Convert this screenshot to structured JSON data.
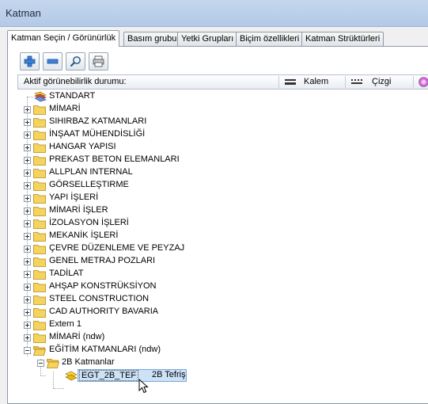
{
  "window": {
    "title": "Katman"
  },
  "tabs": [
    {
      "label": "Katman Seçin / Görünürlük"
    },
    {
      "label": "Basım grubu"
    },
    {
      "label": "Yetki Grupları"
    },
    {
      "label": "Biçim özellikleri"
    },
    {
      "label": "Katman Strüktürleri"
    }
  ],
  "toolbar": {
    "buttons": [
      {
        "icon": "plus-icon"
      },
      {
        "icon": "minus-icon"
      },
      {
        "icon": "magnifier-icon"
      },
      {
        "icon": "printer-icon"
      }
    ]
  },
  "columns": {
    "visibility": "Aktif görünebilirlik durumu:",
    "pen": "Kalem",
    "line": "Çizgi"
  },
  "tree": {
    "items": [
      {
        "label": "STANDART"
      },
      {
        "label": "MİMARİ"
      },
      {
        "label": "SIHIRBAZ KATMANLARI"
      },
      {
        "label": "İNŞAAT MÜHENDİSLİĞİ"
      },
      {
        "label": "HANGAR YAPISI"
      },
      {
        "label": "PREKAST BETON ELEMANLARI"
      },
      {
        "label": "ALLPLAN INTERNAL"
      },
      {
        "label": "GÖRSELLEŞTIRME"
      },
      {
        "label": "YAPI İŞLERİ"
      },
      {
        "label": "MİMARİ İŞLER"
      },
      {
        "label": "İZOLASYON İŞLERİ"
      },
      {
        "label": "MEKANİK İŞLERİ"
      },
      {
        "label": "ÇEVRE DÜZENLEME VE PEYZAJ"
      },
      {
        "label": "GENEL METRAJ POZLARI"
      },
      {
        "label": "TADİLAT"
      },
      {
        "label": "AHŞAP KONSTRÜKSİYON"
      },
      {
        "label": "STEEL CONSTRUCTION"
      },
      {
        "label": "CAD AUTHORITY BAVARIA"
      },
      {
        "label": "Extern 1"
      },
      {
        "label": "MİMARİ (ndw)"
      },
      {
        "label": "EĞİTİM KATMANLARI (ndw)"
      },
      {
        "label": "2B Katmanlar"
      },
      {
        "label": "EGT_2B_TEF",
        "description": "2B Tefriş"
      }
    ]
  },
  "colors": {
    "folder": "#f4d35e",
    "selection": "#cce0f5",
    "titlebar": "#bfd3ec"
  }
}
